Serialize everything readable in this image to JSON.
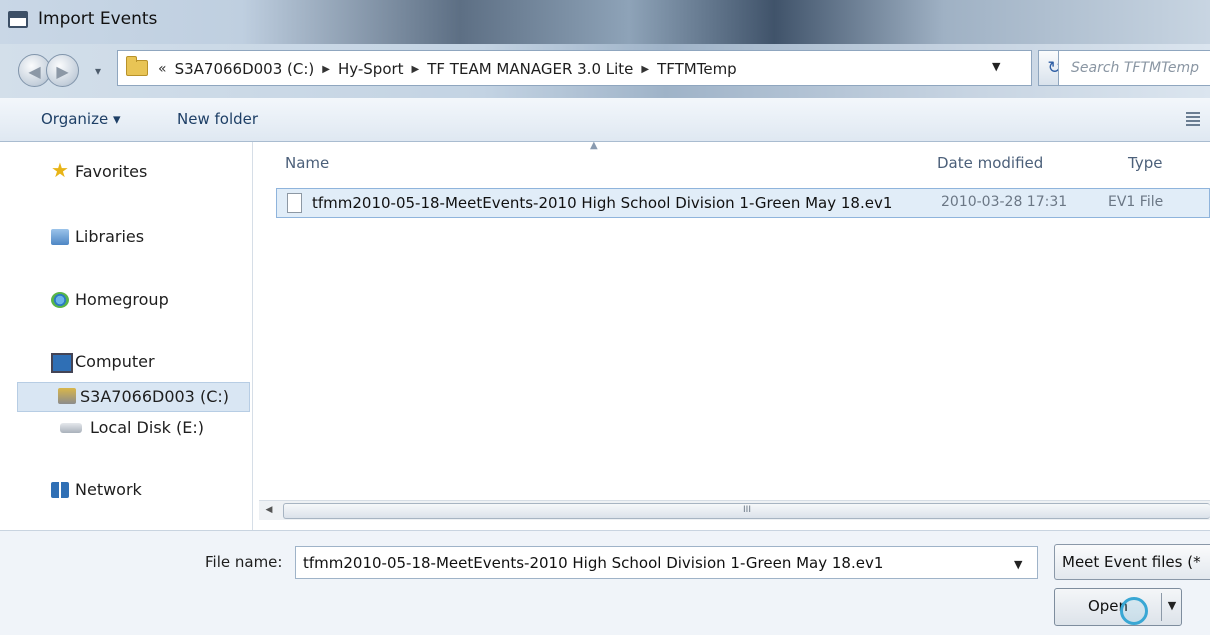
{
  "window": {
    "title": "Import Events"
  },
  "address": {
    "overflow": "«",
    "breadcrumbs": [
      "S3A7066D003 (C:)",
      "Hy-Sport",
      "TF TEAM MANAGER 3.0 Lite",
      "TFTMTemp"
    ]
  },
  "search": {
    "placeholder": "Search TFTMTemp"
  },
  "toolbar": {
    "organize": "Organize ▾",
    "new_folder": "New folder"
  },
  "nav": {
    "favorites": "Favorites",
    "libraries": "Libraries",
    "homegroup": "Homegroup",
    "computer": "Computer",
    "drive_c": "S3A7066D003 (C:)",
    "drive_e": "Local Disk (E:)",
    "network": "Network"
  },
  "columns": {
    "name": "Name",
    "date_modified": "Date modified",
    "type": "Type"
  },
  "files": [
    {
      "name": "tfmm2010-05-18-MeetEvents-2010 High School Division 1-Green May 18.ev1",
      "date": "2010-03-28 17:31",
      "type": "EV1 File"
    }
  ],
  "scrollbar": {
    "grip": "III"
  },
  "footer": {
    "file_name_label": "File name:",
    "file_name_value": "tfmm2010-05-18-MeetEvents-2010 High School Division 1-Green May 18.ev1",
    "filter": "Meet Event files (*",
    "open": "Open"
  },
  "colors": {
    "selection": "#e1edf8",
    "accent": "#1e3f66"
  }
}
